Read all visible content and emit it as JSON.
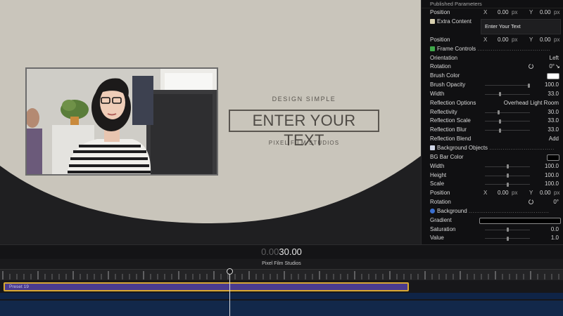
{
  "viewer": {
    "design_simple": "DESIGN SIMPLE",
    "headline": "ENTER YOUR TEXT",
    "studio": "PIXEL FILM STUDIOS"
  },
  "inspector": {
    "header": "Published Parameters",
    "rows": {
      "position1": {
        "label": "Position",
        "x_axis": "X",
        "x_val": "0.00",
        "x_unit": "px",
        "y_axis": "Y",
        "y_val": "0.00",
        "y_unit": "px"
      },
      "extra_content": {
        "label": "Extra Content",
        "text_value": "Enter Your Text"
      },
      "position2": {
        "label": "Position",
        "x_axis": "X",
        "x_val": "0.00",
        "x_unit": "px",
        "y_axis": "Y",
        "y_val": "0.00",
        "y_unit": "px"
      },
      "frame_controls": {
        "label": "Frame Controls",
        "dots": "......................................"
      },
      "orientation": {
        "label": "Orientation",
        "value": "Left"
      },
      "rotation1": {
        "label": "Rotation",
        "value": "0°"
      },
      "brush_color": {
        "label": "Brush Color"
      },
      "brush_opacity": {
        "label": "Brush Opacity",
        "value": "100.0",
        "level": 1.0
      },
      "width1": {
        "label": "Width",
        "value": "33.0",
        "level": 0.33
      },
      "reflection_options": {
        "label": "Reflection Options",
        "value": "Overhead Light Room"
      },
      "reflectivity": {
        "label": "Reflectivity",
        "value": "30.0",
        "level": 0.3
      },
      "reflection_scale": {
        "label": "Reflection Scale",
        "value": "33.0",
        "level": 0.33
      },
      "reflection_blur": {
        "label": "Reflection Blur",
        "value": "33.0",
        "level": 0.33
      },
      "reflection_blend": {
        "label": "Reflection Blend",
        "value": "Add"
      },
      "background_objects": {
        "label": "Background Objects",
        "dots": ".................................."
      },
      "bg_bar_color": {
        "label": "BG Bar Color"
      },
      "width2": {
        "label": "Width",
        "value": "100.0",
        "level": 0.5
      },
      "height": {
        "label": "Height",
        "value": "100.0",
        "level": 0.5
      },
      "scale": {
        "label": "Scale",
        "value": "100.0",
        "level": 0.5
      },
      "position3": {
        "label": "Position",
        "x_axis": "X",
        "x_val": "0.00",
        "x_unit": "px",
        "y_axis": "Y",
        "y_val": "0.00",
        "y_unit": "px"
      },
      "rotation2": {
        "label": "Rotation",
        "value": "0°"
      },
      "background": {
        "label": "Background",
        "dots": ".........................................."
      },
      "gradient": {
        "label": "Gradient"
      },
      "saturation": {
        "label": "Saturation",
        "value": "0.0",
        "level": 0.5
      },
      "value": {
        "label": "Value",
        "value": "1.0",
        "level": 0.5
      }
    },
    "colors": {
      "panel": "#101012",
      "section_icon_green": "#3fa84a",
      "section_icon_blue": "#3a6fd0"
    }
  },
  "timeline": {
    "timecode_dim": "0.00",
    "timecode": "30.00",
    "project_name": "Pixel Film Studios",
    "clip_label": "Preset 19",
    "colors": {
      "clip_fill": "#4a3b8f",
      "clip_border": "#d8a833",
      "track_blue": "#0f2447"
    }
  }
}
